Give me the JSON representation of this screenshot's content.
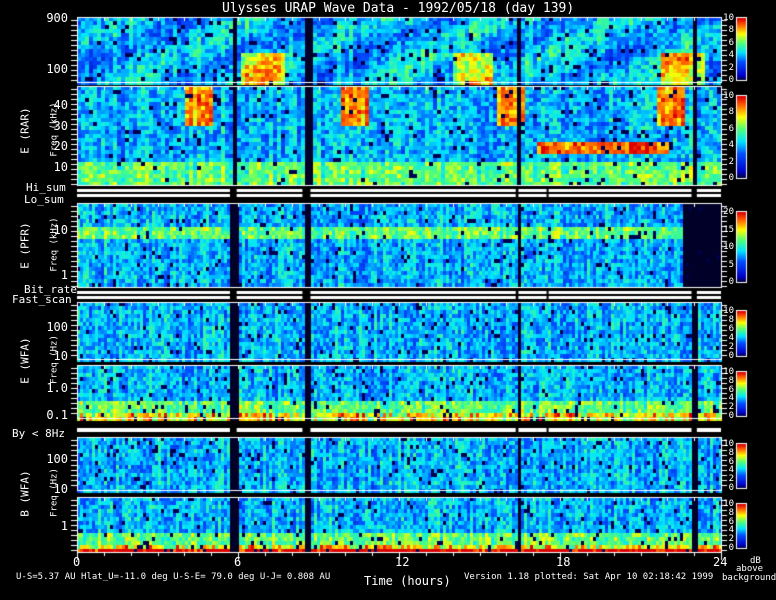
{
  "title": "Ulysses URAP Wave Data - 1992/05/18  (day 139)",
  "chart_data": {
    "type": "heatmap",
    "title": "Ulysses URAP Wave Data - 1992/05/18  (day 139)",
    "xlabel": "Time (hours)",
    "xlim": [
      0,
      24
    ],
    "xticks": [
      "0",
      "6",
      "12",
      "18",
      "24"
    ],
    "colorbar_label": [
      "dB",
      "above",
      "background"
    ],
    "data_gaps_hours": [
      [
        5.7,
        5.95
      ],
      [
        8.4,
        8.7
      ],
      [
        16.35,
        16.45
      ],
      [
        17.5,
        17.55
      ],
      [
        22.9,
        23.1
      ]
    ],
    "groups": [
      {
        "label": "E (RAR)",
        "sublabel": "Freq (kHz)"
      },
      {
        "label": "E (PFR)",
        "sublabel": "Freq (kHz)"
      },
      {
        "label": "E (WFA)",
        "sublabel": "Freq (Hz)"
      },
      {
        "label": "B (WFA)",
        "sublabel": "Freq (Hz)"
      }
    ],
    "panels": [
      {
        "id": "rar-high",
        "yticks": [
          "900",
          "100"
        ],
        "cbar_ticks": [
          "10",
          "8",
          "6",
          "4",
          "2",
          "0"
        ],
        "crange": [
          0,
          10
        ]
      },
      {
        "id": "rar-low",
        "yticks": [
          "40",
          "30",
          "20",
          "10"
        ],
        "cbar_ticks": [
          "10",
          "8",
          "6",
          "4",
          "2",
          "0"
        ],
        "crange": [
          0,
          10
        ]
      },
      {
        "id": "pfr",
        "yticks": [
          "10",
          "1"
        ],
        "cbar_ticks": [
          "20",
          "15",
          "10",
          "5",
          "0"
        ],
        "crange": [
          0,
          20
        ]
      },
      {
        "id": "wfa-e-high",
        "yticks": [
          "100",
          "10"
        ],
        "cbar_ticks": [
          "10",
          "8",
          "6",
          "4",
          "2",
          "0"
        ],
        "crange": [
          0,
          10
        ]
      },
      {
        "id": "wfa-e-low",
        "yticks": [
          "1.0",
          "0.1"
        ],
        "cbar_ticks": [
          "10",
          "8",
          "6",
          "4",
          "2",
          "0"
        ],
        "crange": [
          0,
          10
        ]
      },
      {
        "id": "wfa-b-high",
        "yticks": [
          "100",
          "10"
        ],
        "cbar_ticks": [
          "10",
          "8",
          "6",
          "4",
          "2",
          "0"
        ],
        "crange": [
          0,
          10
        ]
      },
      {
        "id": "wfa-b-low",
        "yticks": [
          "1"
        ],
        "cbar_ticks": [
          "10",
          "8",
          "6",
          "4",
          "2",
          "0"
        ],
        "crange": [
          0,
          10
        ]
      }
    ],
    "status_bars": [
      "Hi_sum",
      "Lo_sum",
      "Bit_rate",
      "Fast_scan",
      "By < 8Hz"
    ]
  },
  "footer": {
    "orbit": "U-S=5.37 AU  Hlat_U=-11.0 deg  U-S-E= 79.0 deg  U-J= 0.808 AU",
    "version": "Version 1.18 plotted: Sat Apr 10 02:18:42 1999"
  }
}
